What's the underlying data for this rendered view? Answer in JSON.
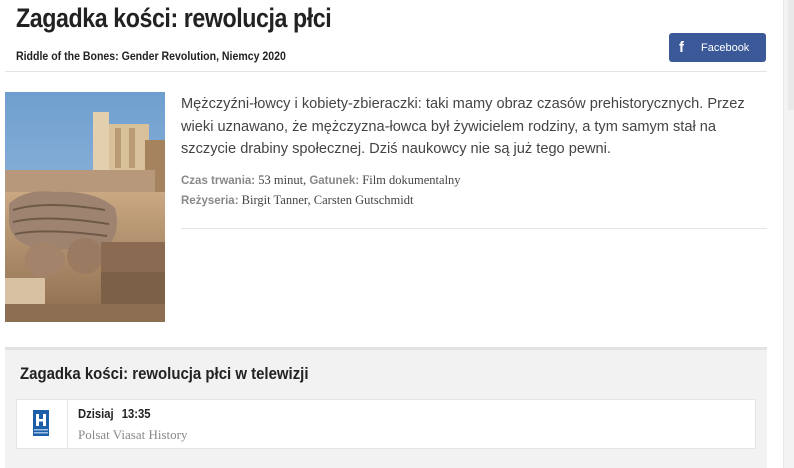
{
  "page": {
    "title": "Zagadka kości: rewolucja płci",
    "subtitle": "Riddle of the Bones: Gender Revolution, Niemcy 2020"
  },
  "share": {
    "facebook_label": "Facebook",
    "icon": "facebook-icon"
  },
  "description": "Mężczyźni-łowcy i kobiety-zbieraczki: taki mamy obraz czasów prehistorycznych. Przez wieki uznawano, że mężczyzna-łowca był żywicielem rodziny, a tym samym stał na szczycie drabiny społecznej. Dziś naukowcy nie są już tego pewni.",
  "meta": {
    "duration_label": "Czas trwania:",
    "duration": "53 minut,",
    "genre_label": "Gatunek:",
    "genre": "Film dokumentalny",
    "directors_label": "Reżyseria:",
    "directors": "Birgit Tanner, Carsten Gutschmidt"
  },
  "tv": {
    "heading": "Zagadka kości: rewolucja płci w telewizji",
    "schedule": [
      {
        "day": "Dzisiaj",
        "time": "13:35",
        "channel": "Polsat Viasat History",
        "logo_icon": "history-channel-logo-icon"
      }
    ]
  },
  "colors": {
    "facebook": "#3b5998",
    "logo_blue": "#1c5ea8"
  }
}
